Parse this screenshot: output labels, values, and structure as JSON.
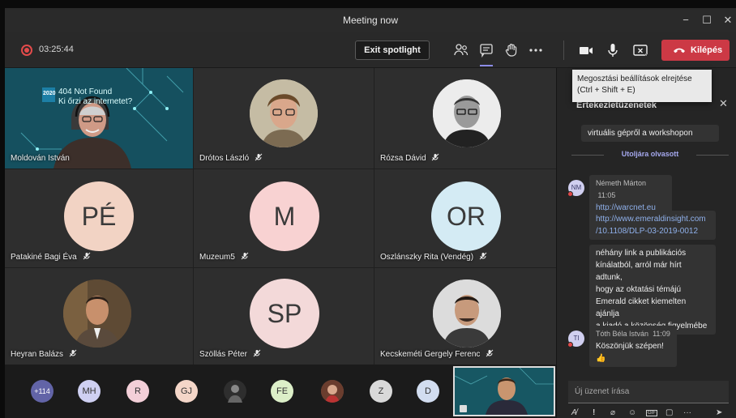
{
  "window": {
    "title": "Meeting now",
    "minimize": "−",
    "maximize": "☐",
    "close": "✕"
  },
  "toolbar": {
    "timer": "03:25:44",
    "exit_spotlight": "Exit spotlight",
    "leave_label": "Kilépés",
    "icons": [
      "participants-icon",
      "chat-icon",
      "raise-hand-icon",
      "more-icon",
      "camera-icon",
      "mic-icon",
      "share-tray-icon"
    ]
  },
  "tooltip": {
    "line1": "Megosztási beállítások elrejtése",
    "line2": "(Ctrl + Shift + E)"
  },
  "tiles": [
    {
      "name": "Moldován István",
      "banner_year": "2020",
      "banner_line1": "404 Not Found",
      "banner_line2": "Ki őrzi az internetet?"
    },
    {
      "name": "Drótos László"
    },
    {
      "name": "Rózsa Dávid"
    },
    {
      "name": "Patakiné Bagi Éva",
      "initials": "PÉ"
    },
    {
      "name": "Muzeum5",
      "initials": "M"
    },
    {
      "name": "Oszlánszky Rita (Vendég)",
      "initials": "OR"
    },
    {
      "name": "Heyran Balázs"
    },
    {
      "name": "Szöllás Péter",
      "initials": "SP"
    },
    {
      "name": "Kecskeméti Gergely Ferenc"
    }
  ],
  "strip": {
    "overflow_count": "+114",
    "avatars": [
      "MH",
      "R",
      "GJ",
      "FE",
      "Z",
      "D"
    ]
  },
  "chat": {
    "header": "Értekezletüzenetek",
    "close": "✕",
    "prev_message": "virtuális gépről a workshopon",
    "last_read": "Utoljára olvasott",
    "messages": [
      {
        "initials": "NM",
        "author": "Németh Márton",
        "time": "11:05",
        "link1": "http://warcnet.eu",
        "link2a": "http://www.emeraldinsight.com",
        "link2b": "/10.1108/DLP-03-2019-0012",
        "text_lines": [
          "néhány link a publikációs",
          "kínálatból, arról már hírt adtunk,",
          "hogy az oktatási témájú",
          "Emerald cikket kiemelten ajánlja",
          "a kiadó a közönség figyelmébe"
        ]
      },
      {
        "initials": "TI",
        "author": "Tóth Béla István",
        "time": "11:09",
        "text": "Köszönjük szépen!👍"
      }
    ],
    "compose_placeholder": "Új üzenet írása",
    "send_icon": "send-icon"
  },
  "colors": {
    "leave": "#cc3945",
    "accent": "#8c8ce6",
    "pe": "#f2d3c4",
    "m": "#f8d2d2",
    "or": "#d4ebf4",
    "sp": "#f3d9d9"
  }
}
